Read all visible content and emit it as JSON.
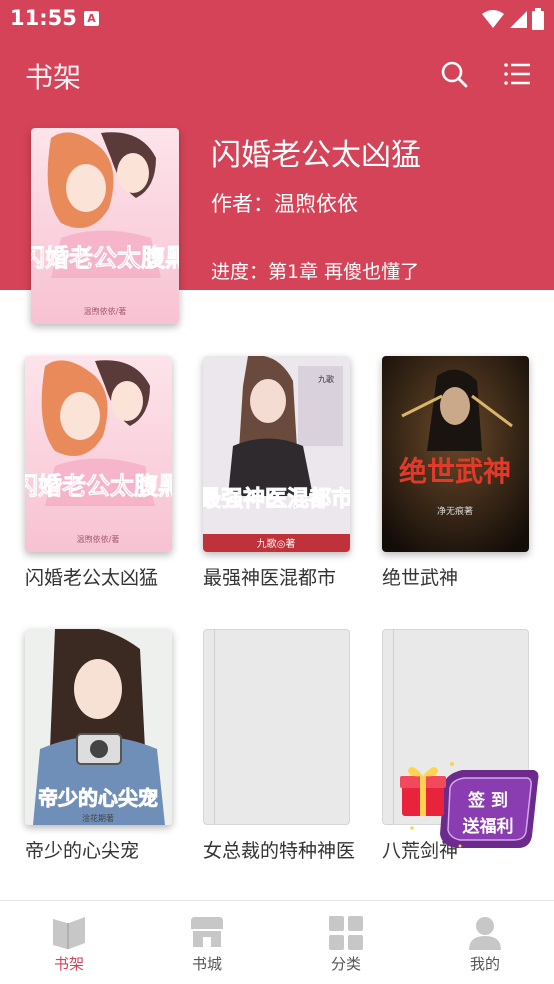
{
  "status_bar": {
    "time": "11:55",
    "app_icon": "A"
  },
  "toolbar": {
    "title": "书架",
    "search_icon": "search-icon",
    "menu_icon": "menu-icon"
  },
  "featured": {
    "title": "闪婚老公太凶猛",
    "author": "作者：温煦依依",
    "progress": "进度：第1章 再傻也懂了",
    "cover_text": "闪婚老公太腹黑",
    "cover_author": "温煦依依/著"
  },
  "books": [
    {
      "title": "闪婚老公太凶猛",
      "cover_text": "闪婚老公太腹黑",
      "cover_author": "温煦依依/著"
    },
    {
      "title": "最强神医混都市",
      "cover_text": "最强神医混都市",
      "cover_author": "九歌◎著",
      "cover_top": "九歌"
    },
    {
      "title": "绝世武神",
      "cover_text": "绝世武神",
      "cover_author": "净无痕著"
    },
    {
      "title": "帝少的心尖宠",
      "cover_text": "帝少的心尖宠",
      "cover_author": "淦花期著"
    },
    {
      "title": "女总裁的特种神医"
    },
    {
      "title": "八荒剑神"
    }
  ],
  "sign_in": {
    "line1": "签  到",
    "line2": "送福利"
  },
  "bottom_nav": [
    {
      "label": "书架",
      "icon": "bookshelf-icon",
      "active": true
    },
    {
      "label": "书城",
      "icon": "bookstore-icon",
      "active": false
    },
    {
      "label": "分类",
      "icon": "category-icon",
      "active": false
    },
    {
      "label": "我的",
      "icon": "profile-icon",
      "active": false
    }
  ],
  "colors": {
    "accent": "#d54358",
    "nav_inactive": "#c7c7c7",
    "badge_purple": "#6b2a8c"
  }
}
